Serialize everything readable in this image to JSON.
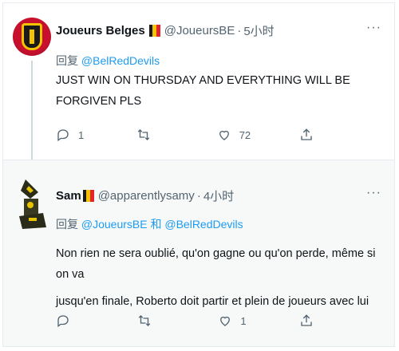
{
  "tweets": [
    {
      "display_name": "Joueurs Belges",
      "handle": "@JoueursBE",
      "separator": "·",
      "time": "5小时",
      "more": "···",
      "reply_prefix": "回复",
      "reply_to_1": "@BelRedDevils",
      "text": "JUST WIN ON THURSDAY AND EVERYTHING WILL BE FORGIVEN PLS",
      "reply_count": "1",
      "retweet_count": "",
      "like_count": "72"
    },
    {
      "display_name": "Sam",
      "handle": "@apparentlysamy",
      "separator": "·",
      "time": "4小时",
      "more": "···",
      "reply_prefix": "回复",
      "reply_to_1": "@JoueursBE",
      "reply_and": "和",
      "reply_to_2": "@BelRedDevils",
      "text_line1": "Non rien ne sera oublié, qu'on gagne ou qu'on perde, même si on va",
      "text_line2": "jusqu'en finale, Roberto doit partir et plein de joueurs avec lui",
      "reply_count": "",
      "retweet_count": "",
      "like_count": "1"
    }
  ],
  "colors": {
    "accent": "#1d9bf0",
    "muted": "#536471",
    "flag_black": "#1a1a1a",
    "flag_yellow": "#f4c400",
    "flag_red": "#e3242b"
  }
}
